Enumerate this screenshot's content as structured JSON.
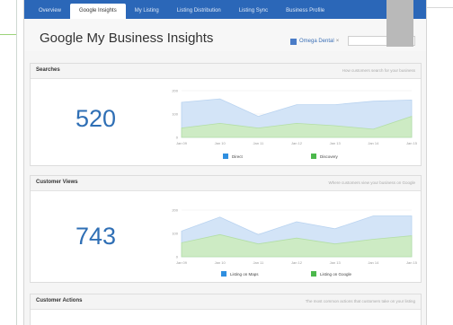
{
  "nav": {
    "tabs": [
      "Overview",
      "Google Insights",
      "My Listing",
      "Listing Distribution",
      "Listing Sync",
      "Business Profile"
    ],
    "active": "Google Insights"
  },
  "header": {
    "title": "Google My Business Insights",
    "business_chip": "Omega Dental",
    "select_value": "↕"
  },
  "colors": {
    "nav": "#2b67b8",
    "series_blue": "#cfe2f7",
    "series_green": "#c9e8bf",
    "number": "#2f6fb5"
  },
  "panels": {
    "searches": {
      "title": "Searches",
      "description": "How customers search for your business",
      "total": "520"
    },
    "views": {
      "title": "Customer Views",
      "description": "Where customers view your business on Google",
      "total": "743"
    },
    "actions": {
      "title": "Customer Actions",
      "description": "The most common actions that customers take on your listing"
    }
  },
  "chart_data": [
    {
      "type": "area",
      "x": [
        "Jan 09",
        "Jan 10",
        "Jan 11",
        "Jan 12",
        "Jan 13",
        "Jan 14",
        "Jan 15"
      ],
      "yticks": [
        "200",
        "100",
        "0"
      ],
      "ylim": [
        0,
        200
      ],
      "series": [
        {
          "name": "Direct",
          "values": [
            150,
            165,
            90,
            140,
            140,
            155,
            160
          ]
        },
        {
          "name": "Discovery",
          "values": [
            40,
            60,
            40,
            60,
            50,
            35,
            90
          ]
        }
      ]
    },
    {
      "type": "area",
      "x": [
        "Jan 09",
        "Jan 10",
        "Jan 11",
        "Jan 12",
        "Jan 13",
        "Jan 14",
        "Jan 15"
      ],
      "yticks": [
        "200",
        "100",
        "0"
      ],
      "ylim": [
        0,
        200
      ],
      "series": [
        {
          "name": "Listing on Maps",
          "values": [
            110,
            170,
            95,
            150,
            120,
            175,
            175
          ]
        },
        {
          "name": "Listing on Google",
          "values": [
            60,
            95,
            55,
            80,
            55,
            75,
            90
          ]
        }
      ]
    }
  ]
}
